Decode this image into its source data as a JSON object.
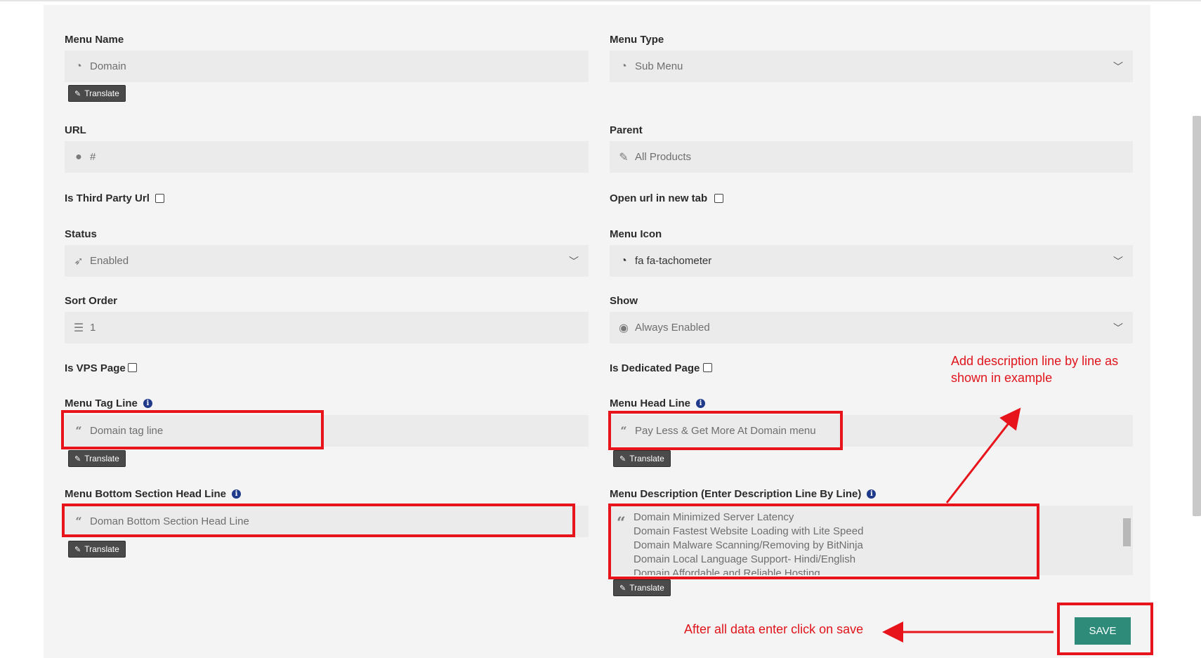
{
  "form": {
    "menu_name": {
      "label": "Menu Name",
      "value": "Domain"
    },
    "menu_type": {
      "label": "Menu Type",
      "value": "Sub Menu"
    },
    "url": {
      "label": "URL",
      "value": "#"
    },
    "parent": {
      "label": "Parent",
      "value": "All Products"
    },
    "is_third_party_url": {
      "label": "Is Third Party Url",
      "checked": false
    },
    "open_in_new_tab": {
      "label": "Open url in new tab",
      "checked": false
    },
    "status": {
      "label": "Status",
      "value": "Enabled"
    },
    "menu_icon": {
      "label": "Menu Icon",
      "value": "fa fa-tachometer"
    },
    "sort_order": {
      "label": "Sort Order",
      "value": "1"
    },
    "show": {
      "label": "Show",
      "value": "Always Enabled"
    },
    "is_vps_page": {
      "label": "Is VPS Page",
      "checked": false
    },
    "is_dedicated_page": {
      "label": "Is Dedicated Page",
      "checked": false
    },
    "menu_tag_line": {
      "label": "Menu Tag Line",
      "placeholder": "Domain tag line"
    },
    "menu_head_line": {
      "label": "Menu Head Line",
      "placeholder": "Pay Less & Get More At Domain menu"
    },
    "menu_bottom_head_line": {
      "label": "Menu Bottom Section Head Line",
      "placeholder": "Doman Bottom Section Head Line"
    },
    "menu_description": {
      "label": "Menu Description (Enter Description Line By Line)",
      "lines": [
        "Domain Minimized Server Latency",
        "Domain  Fastest Website Loading with Lite Speed",
        "Domain Malware Scanning/Removing by BitNinja",
        "Domain Local Language Support- Hindi/English",
        "Domain Affordable and Reliable Hosting"
      ]
    },
    "translate_label": "Translate",
    "save_label": "SAVE"
  },
  "annotations": {
    "description_note": [
      "Add description line by line as",
      "shown in example"
    ],
    "save_note": "After all data enter click on save"
  },
  "colors": {
    "accent_red": "#e8141c",
    "save_green": "#2e8b7a"
  },
  "icons": {
    "menu_name": "tachometer-icon",
    "url": "globe-icon",
    "parent": "edit-icon",
    "status": "rocket-icon",
    "sort_order": "list-icon",
    "show": "eye-icon",
    "tag_line": "quote-icon"
  }
}
